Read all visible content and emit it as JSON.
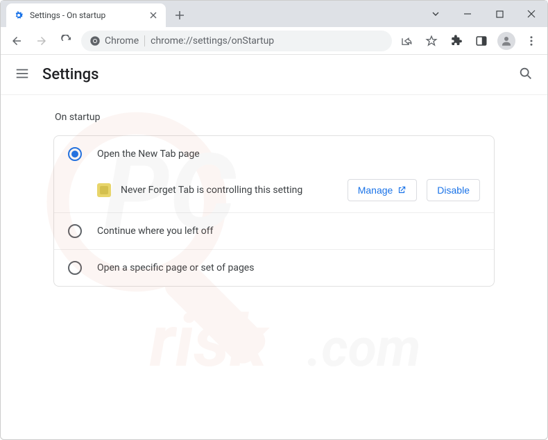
{
  "window": {
    "tab_title": "Settings - On startup"
  },
  "omnibox": {
    "secure_label": "Chrome",
    "url": "chrome://settings/onStartup"
  },
  "header": {
    "title": "Settings"
  },
  "section": {
    "title": "On startup"
  },
  "options": {
    "open_new_tab": "Open the New Tab page",
    "continue": "Continue where you left off",
    "specific": "Open a specific page or set of pages"
  },
  "controlled": {
    "text": "Never Forget Tab is controlling this setting",
    "manage_label": "Manage",
    "disable_label": "Disable"
  },
  "watermark": {
    "text": "PCrisk.com"
  }
}
